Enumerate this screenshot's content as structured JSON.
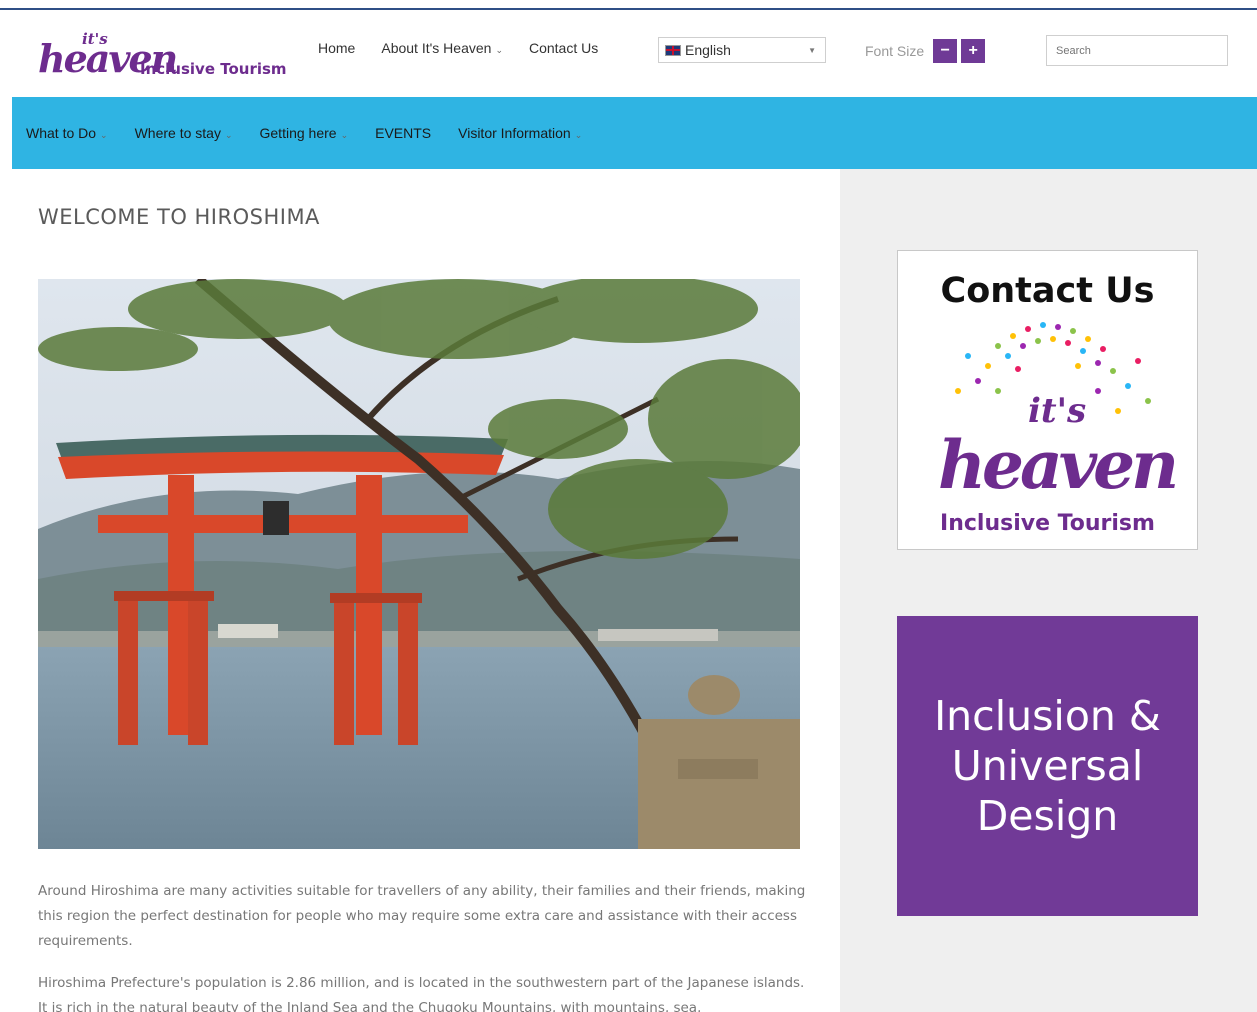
{
  "brand": {
    "logo_script": "heaven",
    "logo_its": "it's",
    "logo_subtitle": "Inclusive Tourism"
  },
  "top_nav": [
    {
      "label": "Home",
      "has_dropdown": false
    },
    {
      "label": "About It's Heaven",
      "has_dropdown": true
    },
    {
      "label": "Contact Us",
      "has_dropdown": false
    }
  ],
  "language": {
    "selected": "English"
  },
  "font_size": {
    "label": "Font Size",
    "decrease": "−",
    "increase": "+"
  },
  "search": {
    "placeholder": "Search"
  },
  "main_nav": [
    {
      "label": "What to Do",
      "has_dropdown": true
    },
    {
      "label": "Where to stay",
      "has_dropdown": true
    },
    {
      "label": "Getting here",
      "has_dropdown": true
    },
    {
      "label": "EVENTS",
      "has_dropdown": false
    },
    {
      "label": "Visitor Information",
      "has_dropdown": true
    }
  ],
  "content": {
    "title": "WELCOME TO HIROSHIMA",
    "paragraphs": [
      "Around Hiroshima are many activities suitable for travellers of any ability, their families and their friends, making this region the perfect destination for people who may require some extra care and assistance with their access requirements.",
      "Hiroshima Prefecture's population is 2.86 million, and is located in the southwestern part of the Japanese islands. It is rich in the natural beauty of the Inland Sea and the Chugoku Mountains, with mountains, sea,"
    ]
  },
  "sidebar": {
    "contact_card": {
      "title": "Contact Us",
      "logo_its": "it's",
      "logo_script": "heaven",
      "logo_subtitle": "Inclusive Tourism"
    },
    "inclusion_card": {
      "text": "Inclusion & Universal Design"
    }
  },
  "colors": {
    "brand_purple": "#6d2c8e",
    "nav_blue": "#2fb4e3",
    "card_purple": "#713a97",
    "sidebar_bg": "#efefef",
    "torii_red": "#d9482a"
  }
}
